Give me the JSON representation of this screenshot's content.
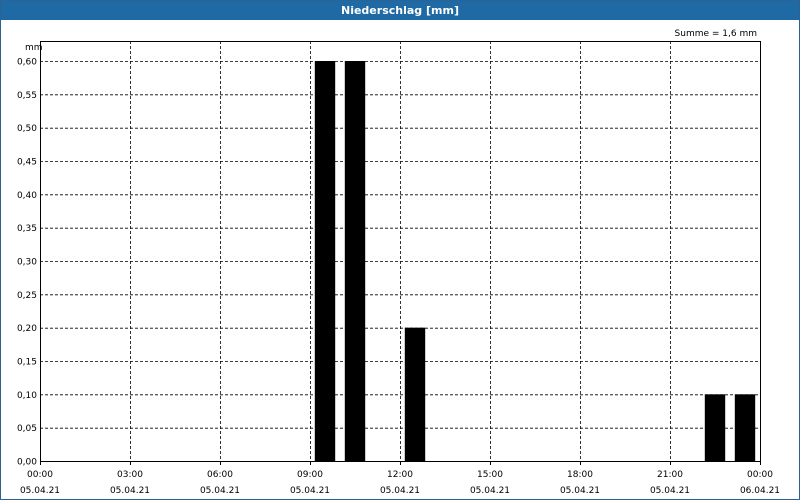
{
  "window": {
    "title": "Niederschlag [mm]"
  },
  "chart_data": {
    "type": "bar",
    "title": "Niederschlag [mm]",
    "ylabel": "mm",
    "annotation": "Summe = 1,6 mm",
    "ylim": [
      0,
      0.6
    ],
    "yticks": [
      0,
      0.05,
      0.1,
      0.15,
      0.2,
      0.25,
      0.3,
      0.35,
      0.4,
      0.45,
      0.5,
      0.55,
      0.6
    ],
    "ytick_labels": [
      "0,00",
      "0,05",
      "0,10",
      "0,15",
      "0,20",
      "0,25",
      "0,30",
      "0,35",
      "0,40",
      "0,45",
      "0,50",
      "0,55",
      "0,60"
    ],
    "xlim_hours": [
      0,
      24
    ],
    "xticks": [
      {
        "hour": 0,
        "time": "00:00",
        "date": "05.04.21"
      },
      {
        "hour": 3,
        "time": "03:00",
        "date": "05.04.21"
      },
      {
        "hour": 6,
        "time": "06:00",
        "date": "05.04.21"
      },
      {
        "hour": 9,
        "time": "09:00",
        "date": "05.04.21"
      },
      {
        "hour": 12,
        "time": "12:00",
        "date": "05.04.21"
      },
      {
        "hour": 15,
        "time": "15:00",
        "date": "05.04.21"
      },
      {
        "hour": 18,
        "time": "18:00",
        "date": "05.04.21"
      },
      {
        "hour": 21,
        "time": "21:00",
        "date": "05.04.21"
      },
      {
        "hour": 24,
        "time": "00:00",
        "date": "06.04.21"
      }
    ],
    "bars": [
      {
        "hour": 9.5,
        "value": 0.6
      },
      {
        "hour": 10.5,
        "value": 0.6
      },
      {
        "hour": 12.5,
        "value": 0.2
      },
      {
        "hour": 22.5,
        "value": 0.1
      },
      {
        "hour": 23.5,
        "value": 0.1
      }
    ],
    "grid": true,
    "colors": {
      "bar": "#000000",
      "titlebar": "#1f6aa5",
      "grid": "#000000"
    }
  }
}
